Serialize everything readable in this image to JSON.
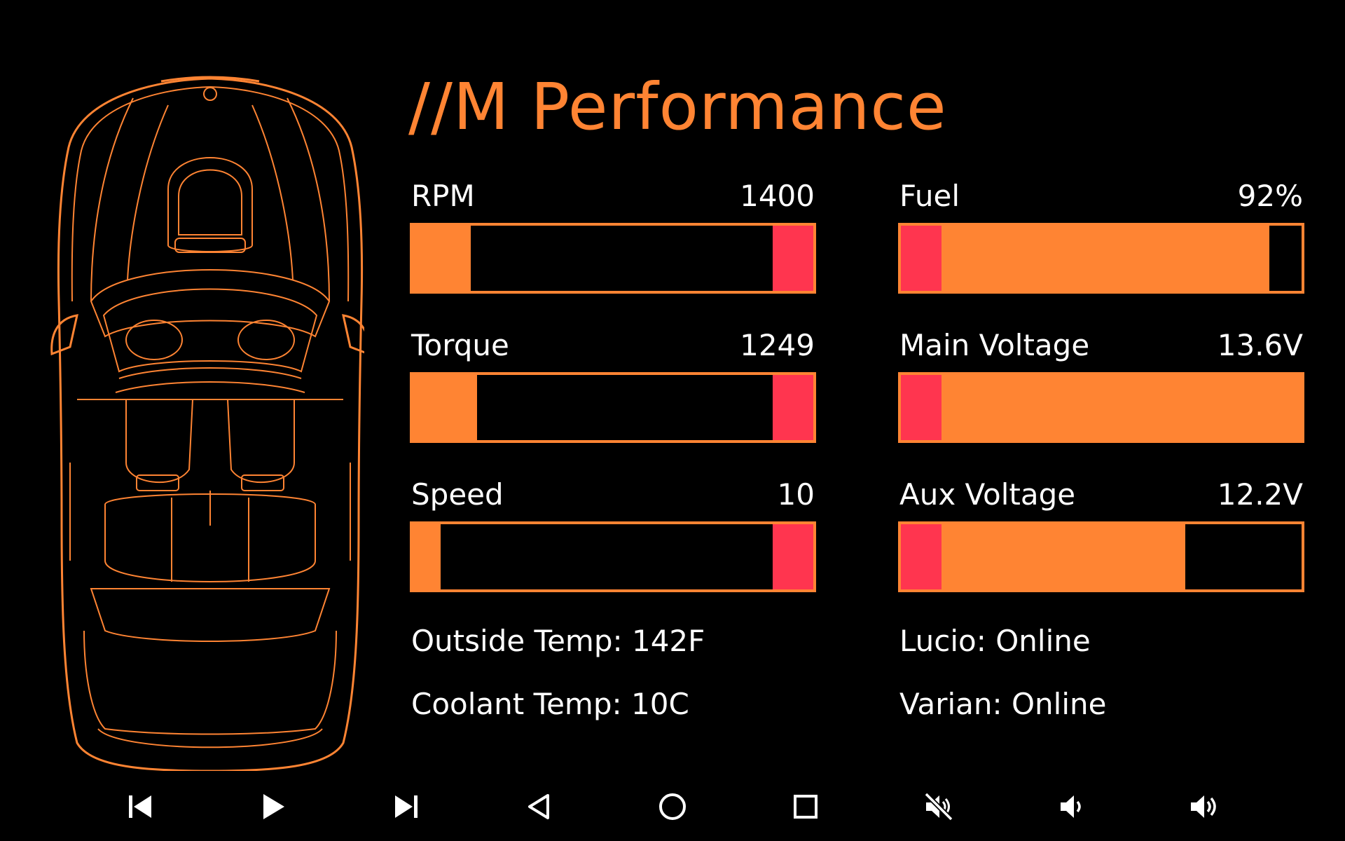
{
  "title": "//M Performance",
  "colors": {
    "accent": "#FF8433",
    "danger": "#FF354F",
    "text": "#FFFFFF",
    "background": "#000000"
  },
  "gauges": {
    "rpm": {
      "label": "RPM",
      "value": "1400",
      "fill_fraction": 0.145,
      "danger_zone": "right"
    },
    "torque": {
      "label": "Torque",
      "value": "1249",
      "fill_fraction": 0.16,
      "danger_zone": "right"
    },
    "speed": {
      "label": "Speed",
      "value": "10",
      "fill_fraction": 0.07,
      "danger_zone": "right"
    },
    "fuel": {
      "label": "Fuel",
      "value": "92%",
      "fill_fraction": 0.92,
      "danger_zone": "left"
    },
    "main_voltage": {
      "label": "Main Voltage",
      "value": "13.6V",
      "fill_fraction": 1.0,
      "danger_zone": "left"
    },
    "aux_voltage": {
      "label": "Aux Voltage",
      "value": "12.2V",
      "fill_fraction": 0.71,
      "danger_zone": "left"
    }
  },
  "status": {
    "outside_temp": "Outside Temp: 142F",
    "coolant_temp": "Coolant Temp: 10C",
    "lucio": "Lucio: Online",
    "varian": "Varian: Online"
  },
  "nav_icons": [
    "skip-previous-icon",
    "play-icon",
    "skip-next-icon",
    "back-triangle-icon",
    "home-circle-icon",
    "recents-square-icon",
    "mute-icon",
    "volume-down-icon",
    "volume-up-icon"
  ]
}
